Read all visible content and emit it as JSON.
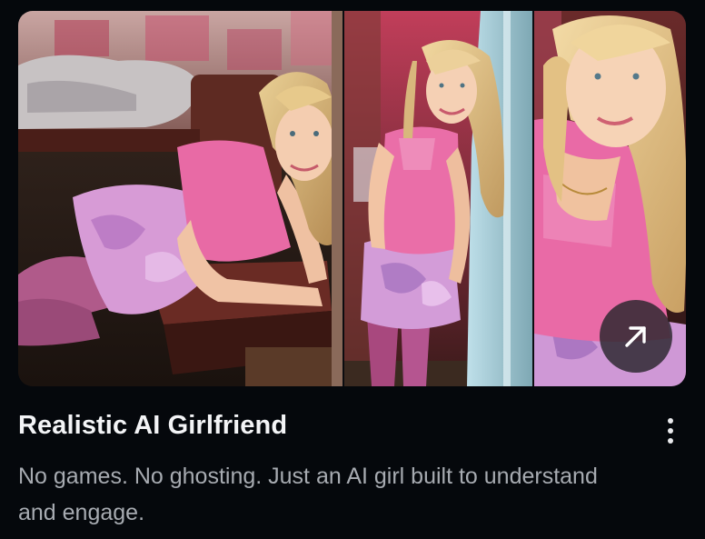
{
  "card": {
    "title": "Realistic AI Girlfriend",
    "description": "No games. No ghosting. Just an AI girl built to understand and engage."
  },
  "image": {
    "panels": [
      {
        "subject": "woman in pink top lying on brown bench"
      },
      {
        "subject": "woman in pink top leaning on doorway"
      },
      {
        "subject": "close-up selfie of smiling woman"
      }
    ]
  },
  "icons": {
    "open": "arrow-up-right-icon",
    "more": "more-vertical-icon"
  },
  "colors": {
    "background": "#05080c",
    "title": "#f3f4f6",
    "description": "#a7abb1",
    "button_bg": "#28262c"
  }
}
